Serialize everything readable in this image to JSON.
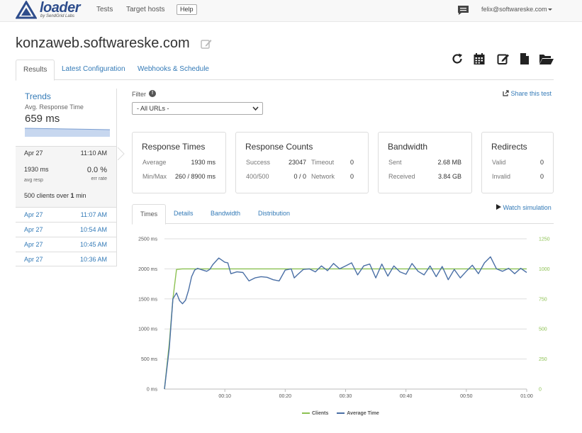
{
  "nav": {
    "logo_text": "loader",
    "logo_sub": "by SendGrid Labs",
    "links": [
      "Tests",
      "Target hosts"
    ],
    "help": "Help",
    "user": "felix@softwareske.com"
  },
  "page": {
    "title": "konzaweb.softwareske.com"
  },
  "tabs": [
    "Results",
    "Latest Configuration",
    "Webhooks & Schedule"
  ],
  "sidebar": {
    "trends_title": "Trends",
    "trends_sub": "Avg. Response Time",
    "trends_value": "659 ms",
    "active_run": {
      "date": "Apr 27",
      "time": "11:10 AM",
      "resp": "1930 ms",
      "resp_label": "avg resp",
      "err": "0.0 %",
      "err_label": "err rate",
      "clients_pre": "500 clients over ",
      "clients_num": "1",
      "clients_post": " min"
    },
    "runs": [
      {
        "date": "Apr 27",
        "time": "11:07 AM"
      },
      {
        "date": "Apr 27",
        "time": "10:54 AM"
      },
      {
        "date": "Apr 27",
        "time": "10:45 AM"
      },
      {
        "date": "Apr 27",
        "time": "10:36 AM"
      }
    ]
  },
  "filter": {
    "label": "Filter",
    "badge": "!",
    "value": "- All URLs -"
  },
  "share": "Share this test",
  "panels": {
    "response_times": {
      "title": "Response Times",
      "avg_label": "Average",
      "avg": "1930 ms",
      "mm_label": "Min/Max",
      "mm": "260 / 8900 ms"
    },
    "response_counts": {
      "title": "Response Counts",
      "success_label": "Success",
      "success": "23047",
      "c4_label": "400/500",
      "c4": "0 / 0",
      "timeout_label": "Timeout",
      "timeout": "0",
      "network_label": "Network",
      "network": "0"
    },
    "bandwidth": {
      "title": "Bandwidth",
      "sent_label": "Sent",
      "sent": "2.68 MB",
      "recv_label": "Received",
      "recv": "3.84 GB"
    },
    "redirects": {
      "title": "Redirects",
      "valid_label": "Valid",
      "valid": "0",
      "invalid_label": "Invalid",
      "invalid": "0"
    }
  },
  "chart_tabs": [
    "Times",
    "Details",
    "Bandwidth",
    "Distribution"
  ],
  "watch": "Watch simulation",
  "colors": {
    "clients": "#8cc152",
    "avg": "#4a6fa5",
    "link": "#337ab7"
  },
  "chart_data": {
    "type": "line",
    "x_ticks": [
      "00:10",
      "00:20",
      "00:30",
      "00:40",
      "00:50",
      "01:00"
    ],
    "y_left_ticks": [
      "0 ms",
      "500 ms",
      "1000 ms",
      "1500 ms",
      "2000 ms",
      "2500 ms"
    ],
    "y_right_ticks": [
      "0",
      "250",
      "500",
      "750",
      "1000",
      "1250"
    ],
    "ylim_left": [
      0,
      2500
    ],
    "ylim_right": [
      0,
      1250
    ],
    "xlim": [
      0,
      60
    ],
    "series": [
      {
        "name": "Clients",
        "axis": "right",
        "x": [
          0,
          0.8,
          1.4,
          2,
          3,
          60
        ],
        "y": [
          0,
          380,
          750,
          995,
          1000,
          1000
        ]
      },
      {
        "name": "Average Time",
        "axis": "left",
        "x": [
          0,
          0.8,
          1.4,
          2,
          2.5,
          3,
          3.5,
          4,
          4.5,
          5,
          5.5,
          6,
          7,
          7.5,
          8,
          9,
          10,
          10.5,
          11,
          12,
          13,
          14,
          15,
          16,
          17,
          18,
          19,
          20,
          21,
          21.5,
          22,
          23,
          24,
          25,
          26,
          27,
          28,
          29,
          30,
          31,
          32,
          33,
          34,
          35,
          36,
          37,
          38,
          39,
          40,
          41,
          42,
          43,
          44,
          45,
          46,
          47,
          48,
          49,
          50,
          51,
          52,
          53,
          54,
          55,
          56,
          57,
          58,
          59,
          60
        ],
        "y": [
          0,
          680,
          1500,
          1600,
          1470,
          1420,
          1480,
          1650,
          1870,
          1980,
          2010,
          1990,
          1960,
          1990,
          2070,
          2180,
          2110,
          2100,
          1920,
          1950,
          1940,
          1800,
          1850,
          1870,
          1860,
          1820,
          1800,
          1980,
          2000,
          1850,
          1900,
          1990,
          2000,
          1950,
          2050,
          1970,
          2090,
          2000,
          2050,
          2100,
          1900,
          2050,
          2080,
          1850,
          2080,
          1880,
          2050,
          1950,
          1910,
          2090,
          1960,
          1900,
          2050,
          1870,
          2040,
          1820,
          1990,
          1850,
          1960,
          2060,
          1920,
          2100,
          2200,
          2000,
          1960,
          2010,
          1920,
          2010,
          1940
        ]
      }
    ],
    "grid": true,
    "legend": "bottom"
  }
}
